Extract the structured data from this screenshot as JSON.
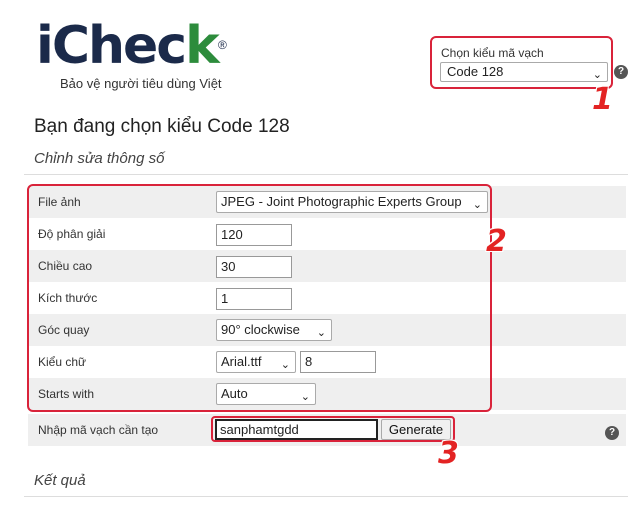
{
  "logo": {
    "brand_main": "iChec",
    "brand_k": "k",
    "registered": "®",
    "tagline": "Bảo vệ người tiêu dùng Việt"
  },
  "barcode_type": {
    "label": "Chọn kiểu mã vạch",
    "selected": "Code 128"
  },
  "page_title": "Bạn đang chọn kiểu Code 128",
  "section_title": "Chỉnh sửa thông số",
  "params": {
    "file": {
      "label": "File ảnh",
      "value": "JPEG - Joint Photographic Experts Group"
    },
    "resolution": {
      "label": "Độ phân giải",
      "value": "120"
    },
    "height": {
      "label": "Chiều cao",
      "value": "30"
    },
    "size": {
      "label": "Kích thước",
      "value": "1"
    },
    "rotation": {
      "label": "Góc quay",
      "value": "90° clockwise"
    },
    "font": {
      "label": "Kiểu chữ",
      "value": "Arial.ttf",
      "size": "8"
    },
    "starts_with": {
      "label": "Starts with",
      "value": "Auto"
    }
  },
  "input": {
    "label": "Nhập mã vạch cần tạo",
    "value": "sanphamtgdd",
    "button": "Generate"
  },
  "result_title": "Kết quả",
  "steps": {
    "one": "1",
    "two": "2",
    "three": "3"
  },
  "help_glyph": "?",
  "accent_color": "#d9233a"
}
